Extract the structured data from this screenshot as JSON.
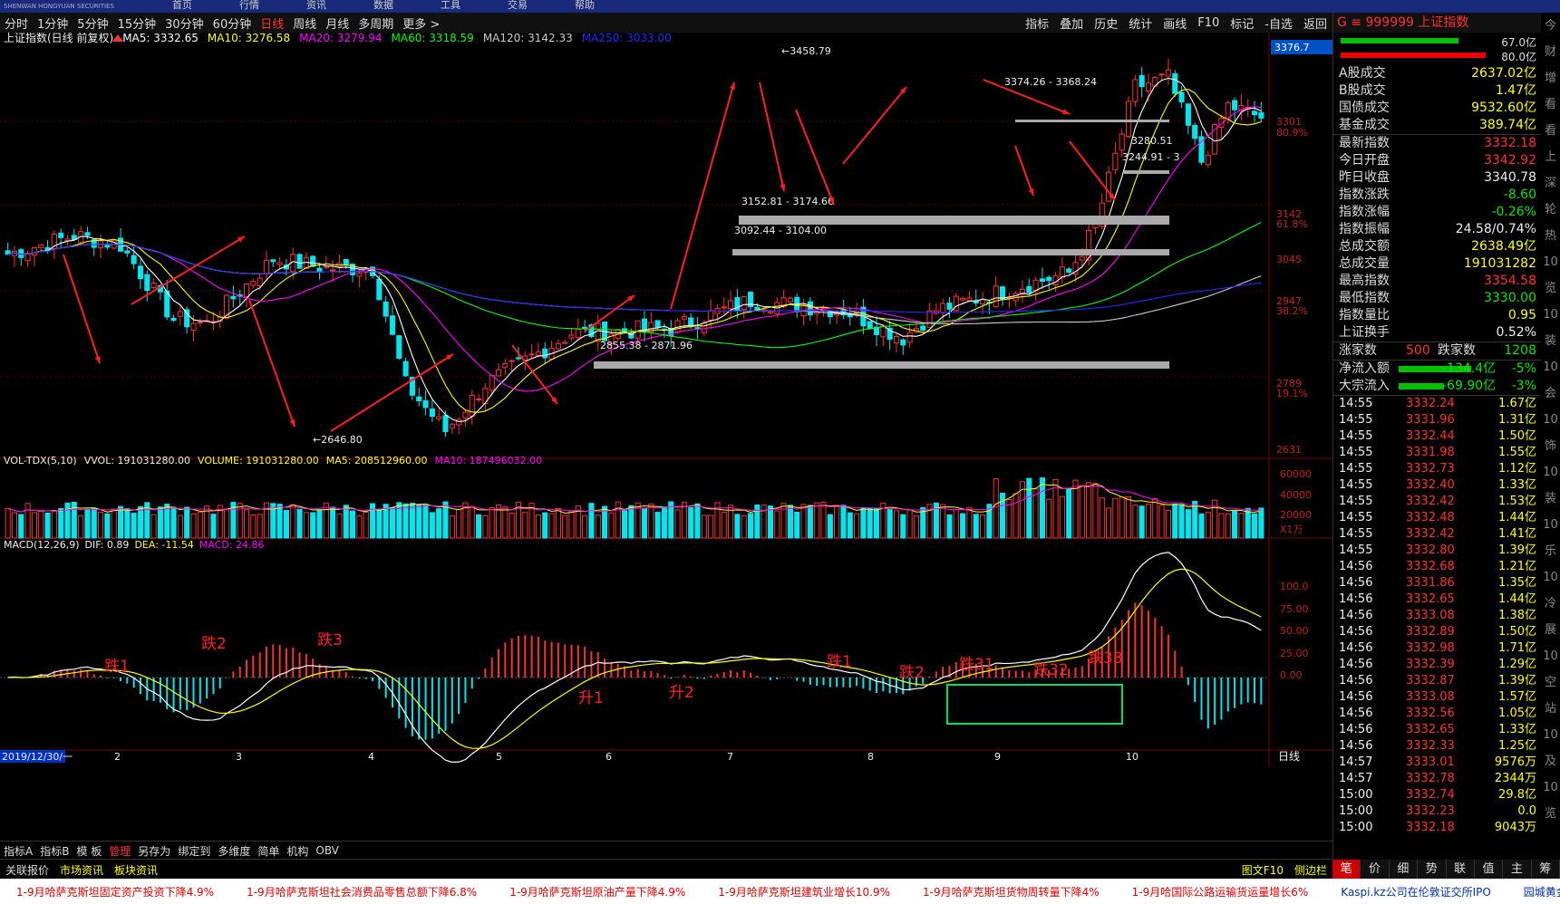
{
  "top_menu": [
    "首页",
    "行情",
    "资讯",
    "数据",
    "工具",
    "交易",
    "帮助"
  ],
  "periods": [
    "分时",
    "1分钟",
    "5分钟",
    "15分钟",
    "30分钟",
    "60分钟",
    "日线",
    "周线",
    "月线",
    "多周期",
    "更多 >"
  ],
  "active_period": "日线",
  "tools": [
    "指标",
    "叠加",
    "历史",
    "统计",
    "画线",
    "F10",
    "标记",
    "-自选",
    "返回"
  ],
  "chart_header": {
    "name": "上证指数(日线 前复权)",
    "ma5": "MA5: 3332.65",
    "ma10": "MA10: 3276.58",
    "ma20": "MA20: 3279.94",
    "ma60": "MA60: 3318.59",
    "ma120": "MA120: 3142.33",
    "ma250": "MA250: 3033.00"
  },
  "price_axis": [
    "3376.7",
    "3301",
    "80.9%",
    "3142",
    "61.8%",
    "3045",
    "2947",
    "38.2%",
    "2789",
    "19.1%",
    "2631"
  ],
  "annotations": {
    "high": "3458.79",
    "low": "2646.80",
    "zone1": "3374.26 - 3368.24",
    "zone2": "3152.81 - 3174.66",
    "zone3": "3092.44 - 3104.00",
    "zone4": "2855.38 - 2871.96",
    "zone5": "3280.51",
    "zone6": "3244.91 - 3"
  },
  "vol_header": {
    "name": "VOL-TDX(5,10)",
    "vvol": "VVOL: 191031280.00",
    "volume": "VOLUME: 191031280.00",
    "ma5": "MA5: 208512960.00",
    "ma10": "MA10: 187496032.00"
  },
  "vol_axis": [
    "60000",
    "40000",
    "20000",
    "X1万"
  ],
  "macd_header": {
    "name": "MACD(12,26,9)",
    "dif": "DIF: 0.89",
    "dea": "DEA: -11.54",
    "macd": "MACD: 24.86"
  },
  "macd_axis": [
    "100.0",
    "75.00",
    "50.00",
    "25.00",
    "0.00"
  ],
  "macd_labels": [
    "跌1",
    "跌2",
    "跌3",
    "升1",
    "升2",
    "跌1",
    "跌2",
    "跌31",
    "跌32",
    "跌33"
  ],
  "date_axis": [
    "2019/12/30/一",
    "2",
    "3",
    "4",
    "5",
    "6",
    "7",
    "8",
    "9",
    "10"
  ],
  "date_axis_right": "日线",
  "bottom_tabs": [
    "指标A",
    "指标B",
    "模 板",
    "管理",
    "另存为",
    "绑定到",
    "多维度",
    "简单",
    "机构",
    "OBV"
  ],
  "bottom_tab_active": "管理",
  "news_bar": [
    "关联报价",
    "市场资讯",
    "板块资讯"
  ],
  "news_bar_right": [
    "图文F10",
    "侧边栏"
  ],
  "right_panel": {
    "title": "G ≡ 999999 上证指数",
    "bar1": "67.0亿",
    "bar2": "80.0亿",
    "stats": [
      {
        "k": "A股成交",
        "v": "2637.02亿",
        "c": "yellow"
      },
      {
        "k": "B股成交",
        "v": "1.47亿",
        "c": "yellow"
      },
      {
        "k": "国债成交",
        "v": "9532.60亿",
        "c": "yellow"
      },
      {
        "k": "基金成交",
        "v": "389.74亿",
        "c": "yellow"
      },
      {
        "k": "最新指数",
        "v": "3332.18",
        "c": "red"
      },
      {
        "k": "今日开盘",
        "v": "3342.92",
        "c": "red"
      },
      {
        "k": "昨日收盘",
        "v": "3340.78",
        "c": "white"
      },
      {
        "k": "指数涨跌",
        "v": "-8.60",
        "c": "green"
      },
      {
        "k": "指数涨幅",
        "v": "-0.26%",
        "c": "green"
      },
      {
        "k": "指数振幅",
        "v": "24.58/0.74%",
        "c": "white"
      },
      {
        "k": "总成交额",
        "v": "2638.49亿",
        "c": "yellow"
      },
      {
        "k": "总成交量",
        "v": "191031282",
        "c": "yellow"
      },
      {
        "k": "最高指数",
        "v": "3354.58",
        "c": "red"
      },
      {
        "k": "最低指数",
        "v": "3330.00",
        "c": "green"
      },
      {
        "k": "指数量比",
        "v": "0.95",
        "c": "yellow"
      },
      {
        "k": "上证换手",
        "v": "0.52%",
        "c": "white"
      }
    ],
    "up_label": "涨家数",
    "up_val": "500",
    "down_label": "跌家数",
    "down_val": "1208",
    "flow1": {
      "k": "净流入额",
      "v": "-134.4亿",
      "p": "-5%"
    },
    "flow2": {
      "k": "大宗流入",
      "v": "-69.90亿",
      "p": "-3%"
    },
    "ticks": [
      [
        "14:55",
        "3332.24",
        "1.67亿"
      ],
      [
        "14:55",
        "3331.96",
        "1.31亿"
      ],
      [
        "14:55",
        "3332.44",
        "1.50亿"
      ],
      [
        "14:55",
        "3331.98",
        "1.55亿"
      ],
      [
        "14:55",
        "3332.73",
        "1.12亿"
      ],
      [
        "14:55",
        "3332.40",
        "1.33亿"
      ],
      [
        "14:55",
        "3332.42",
        "1.53亿"
      ],
      [
        "14:55",
        "3332.48",
        "1.44亿"
      ],
      [
        "14:55",
        "3332.42",
        "1.41亿"
      ],
      [
        "14:55",
        "3332.80",
        "1.39亿"
      ],
      [
        "14:56",
        "3332.68",
        "1.21亿"
      ],
      [
        "14:56",
        "3331.86",
        "1.35亿"
      ],
      [
        "14:56",
        "3332.65",
        "1.44亿"
      ],
      [
        "14:56",
        "3333.08",
        "1.38亿"
      ],
      [
        "14:56",
        "3332.89",
        "1.50亿"
      ],
      [
        "14:56",
        "3332.98",
        "1.71亿"
      ],
      [
        "14:56",
        "3332.39",
        "1.29亿"
      ],
      [
        "14:56",
        "3332.87",
        "1.39亿"
      ],
      [
        "14:56",
        "3333.08",
        "1.57亿"
      ],
      [
        "14:56",
        "3332.56",
        "1.05亿"
      ],
      [
        "14:56",
        "3332.65",
        "1.33亿"
      ],
      [
        "14:56",
        "3332.33",
        "1.25亿"
      ],
      [
        "14:57",
        "3333.01",
        "9576万"
      ],
      [
        "14:57",
        "3332.78",
        "2344万"
      ],
      [
        "15:00",
        "3332.74",
        "29.8亿"
      ],
      [
        "15:00",
        "3332.23",
        "0.0"
      ],
      [
        "15:00",
        "3332.18",
        "9043万"
      ]
    ],
    "bottom_tabs": [
      "笔",
      "价",
      "细",
      "势",
      "联",
      "值",
      "主",
      "筹"
    ]
  },
  "right_strip": [
    "今",
    "财",
    "增",
    "看",
    "看",
    "上",
    "深",
    "轮",
    "热",
    "10",
    "览",
    "10",
    "装",
    "10",
    "会",
    "10",
    "饰",
    "10",
    "装",
    "10",
    "乐",
    "10",
    "冷",
    "展",
    "10",
    "空",
    "站",
    "10",
    "及",
    "10",
    "览"
  ],
  "ticker": [
    "1-9月哈萨克斯坦固定资产投资下降4.9%",
    "1-9月哈萨克斯坦社会消费品零售总额下降6.8%",
    "1-9月哈萨克斯坦原油产量下降4.9%",
    "1-9月哈萨克斯坦建筑业增长10.9%",
    "1-9月哈萨克斯坦货物周转量下降4%",
    "1-9月哈国际公路运输货运量增长6%",
    "Kaspi.kz公司在伦敦证交所IPO",
    "园城黄金 (600766"
  ],
  "colors": {
    "up": "#ff3030",
    "down": "#00e5ee",
    "ma5": "#ffffff",
    "ma10": "#ffff00",
    "ma20": "#ff00ff",
    "ma60": "#00ff00",
    "ma120": "#cccccc",
    "ma250": "#2828ff"
  }
}
